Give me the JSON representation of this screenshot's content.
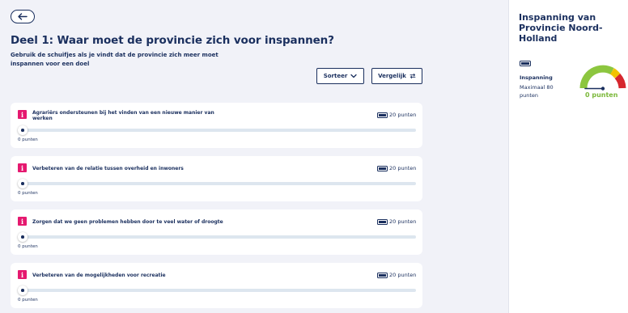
{
  "header": {
    "title": "Deel 1: Waar moet de provincie zich voor inspannen?",
    "subtitle": "Gebruik de schuifjes als je vindt dat de provincie zich meer moet inspannen voor een doel"
  },
  "toolbar": {
    "sort_label": "Sorteer",
    "compare_label": "Vergelijk"
  },
  "goals": [
    {
      "title": "Agrariërs ondersteunen bij het vinden van een nieuwe manier van werken",
      "points": "20 punten",
      "value": "0 punten",
      "level": 0
    },
    {
      "title": "Verbeteren van de relatie tussen overheid en inwoners",
      "points": "20 punten",
      "value": "0 punten",
      "level": 0
    },
    {
      "title": "Zorgen dat we geen problemen hebben door te veel water of droogte",
      "points": "20 punten",
      "value": "0 punten",
      "level": 0
    },
    {
      "title": "Verbeteren van de mogelijkheden voor recreatie",
      "points": "20 punten",
      "value": "0 punten",
      "level": 0
    }
  ],
  "sidebar": {
    "title": "Inspanning van Provincie Noord-Holland",
    "label": "Inspanning",
    "max": "Maximaal 80 punten",
    "gauge_value": "0 punten",
    "gauge_level": 0
  },
  "colors": {
    "navy": "#1a2f5e",
    "info_badge": "#e5196f",
    "gauge_green": "#8cc63f",
    "gauge_yellow": "#f2c200",
    "gauge_red": "#d6262d"
  },
  "icons": {
    "back": "arrow-left-icon",
    "sort": "chevron-down-icon",
    "compare": "swap-arrows-icon",
    "info": "info-icon",
    "points": "battery-icon"
  }
}
